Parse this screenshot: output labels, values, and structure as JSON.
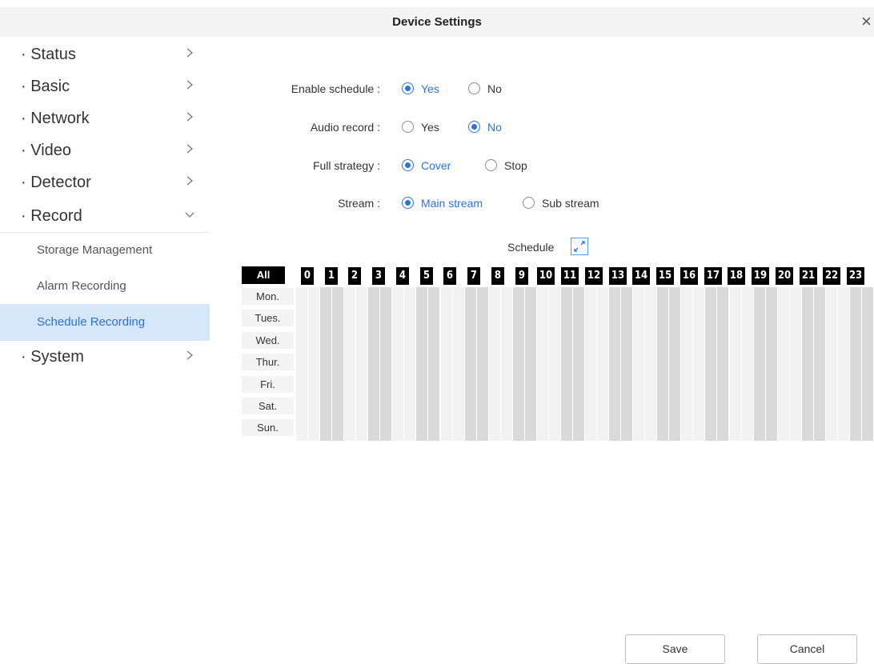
{
  "window": {
    "title": "Device Settings",
    "close_icon": "×"
  },
  "sidebar": {
    "items": [
      {
        "label": "· Status",
        "chevron": "right"
      },
      {
        "label": "· Basic",
        "chevron": "right"
      },
      {
        "label": "· Network",
        "chevron": "right"
      },
      {
        "label": "· Video",
        "chevron": "right"
      },
      {
        "label": "· Detector",
        "chevron": "right"
      },
      {
        "label": "· Record",
        "chevron": "down"
      }
    ],
    "record_subitems": [
      {
        "label": "Storage Management",
        "active": false
      },
      {
        "label": "Alarm Recording",
        "active": false
      },
      {
        "label": "Schedule Recording",
        "active": true
      }
    ],
    "system_item": {
      "label": "· System",
      "chevron": "right"
    }
  },
  "form": {
    "enable_schedule": {
      "label": "Enable schedule :",
      "options": [
        "Yes",
        "No"
      ],
      "selected": "Yes"
    },
    "audio_record": {
      "label": "Audio record :",
      "options": [
        "Yes",
        "No"
      ],
      "selected": "No"
    },
    "full_strategy": {
      "label": "Full strategy :",
      "options": [
        "Cover",
        "Stop"
      ],
      "selected": "Cover"
    },
    "stream": {
      "label": "Stream :",
      "options": [
        "Main stream",
        "Sub stream"
      ],
      "selected": "Main stream"
    }
  },
  "schedule": {
    "title": "Schedule",
    "expand_icon": "expand-icon",
    "all_label": "All",
    "hours": [
      "0",
      "1",
      "2",
      "3",
      "4",
      "5",
      "6",
      "7",
      "8",
      "9",
      "10",
      "11",
      "12",
      "13",
      "14",
      "15",
      "16",
      "17",
      "18",
      "19",
      "20",
      "21",
      "22",
      "23"
    ],
    "days": [
      "Mon.",
      "Tues.",
      "Wed.",
      "Thur.",
      "Fri.",
      "Sat.",
      "Sun."
    ]
  },
  "buttons": {
    "save": "Save",
    "cancel": "Cancel"
  },
  "colors": {
    "accent": "#2b73d8",
    "active_bg": "#d6e6fb",
    "grid_light": "#f2f2f2",
    "grid_dark": "#d9d9d9"
  }
}
